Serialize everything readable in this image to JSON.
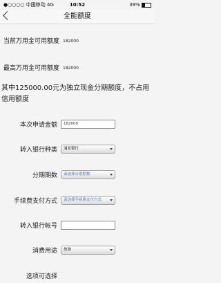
{
  "status_bar": {
    "carrier": "●○○○○ 中国移动  4G",
    "time": "10:52",
    "battery": "39%"
  },
  "header": {
    "title": "全能额度"
  },
  "info": {
    "current_label": "当前万用金可用额度",
    "current_value": "182000",
    "max_label": "最高万用金可用额度",
    "max_value": "182000",
    "note": "其中125000.00元为独立现金分期额度，不占用信用额度"
  },
  "form": {
    "amount_label": "本次申请金额",
    "amount_value": "182000",
    "bank_label": "转入银行种类",
    "bank_value": "浦发银行",
    "period_label": "分期期数",
    "period_value": "请选择分期期数",
    "fee_label": "手续费支付方式",
    "fee_value": "请选择手续费支付方式",
    "account_label": "转入银行帐号",
    "account_value": "",
    "purpose_label": "消费用途",
    "purpose_value": "旅游",
    "partial_label": "选项可选择"
  }
}
